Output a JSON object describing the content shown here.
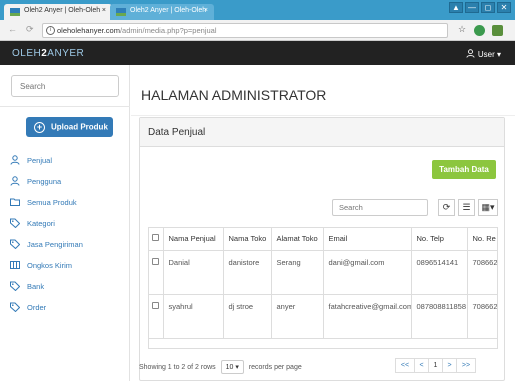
{
  "browser": {
    "tabs": [
      {
        "title": "Oleh2 Anyer | Oleh-Oleh",
        "close": "×"
      },
      {
        "title": "Oleh2 Anyer | Oleh-Oleh",
        "close": "×"
      }
    ],
    "window_buttons": [
      "▲",
      "—",
      "◻",
      "✕"
    ],
    "url_host": "oleholehanyer.com",
    "url_path": "/admin/media.php?p=penjual"
  },
  "app": {
    "brand_prefix": "OLEH",
    "brand_number": "2",
    "brand_suffix": "ANYER",
    "user_label": "User ▾"
  },
  "sidebar": {
    "search_placeholder": "Search",
    "upload_label": "Upload Produk",
    "items": [
      {
        "label": "Penjual",
        "icon": "user-icon"
      },
      {
        "label": "Pengguna",
        "icon": "user-icon"
      },
      {
        "label": "Semua Produk",
        "icon": "folder-icon"
      },
      {
        "label": "Kategori",
        "icon": "tag-icon"
      },
      {
        "label": "Jasa Pengiriman",
        "icon": "tag-icon"
      },
      {
        "label": "Ongkos Kirim",
        "icon": "columns-icon"
      },
      {
        "label": "Bank",
        "icon": "tag-icon"
      },
      {
        "label": "Order",
        "icon": "tag-icon"
      }
    ]
  },
  "main": {
    "page_title": "HALAMAN ADMINISTRATOR",
    "panel_title": "Data Penjual",
    "add_button": "Tambah Data",
    "table_search_placeholder": "Search",
    "toolbar": {
      "refresh": "⟳",
      "toggle": "☰",
      "columns": "▦▾"
    },
    "columns": [
      "Nama Penjual",
      "Nama Toko",
      "Alamat Toko",
      "Email",
      "No. Telp",
      "No. Re"
    ],
    "rows": [
      [
        "Danial",
        "danistore",
        "Serang",
        "dani@gmail.com",
        "0896514141",
        "708662"
      ],
      [
        "syahrul",
        "dj stroe",
        "anyer",
        "fatahcreative@gmail.com",
        "087808811858",
        "708662"
      ]
    ],
    "showing_text": "Showing 1 to 2 of 2 rows",
    "page_size": "10 ▾",
    "records_text": "records per page",
    "pager": [
      "<<",
      "<",
      "1",
      ">",
      ">>"
    ],
    "current_page": "1"
  }
}
